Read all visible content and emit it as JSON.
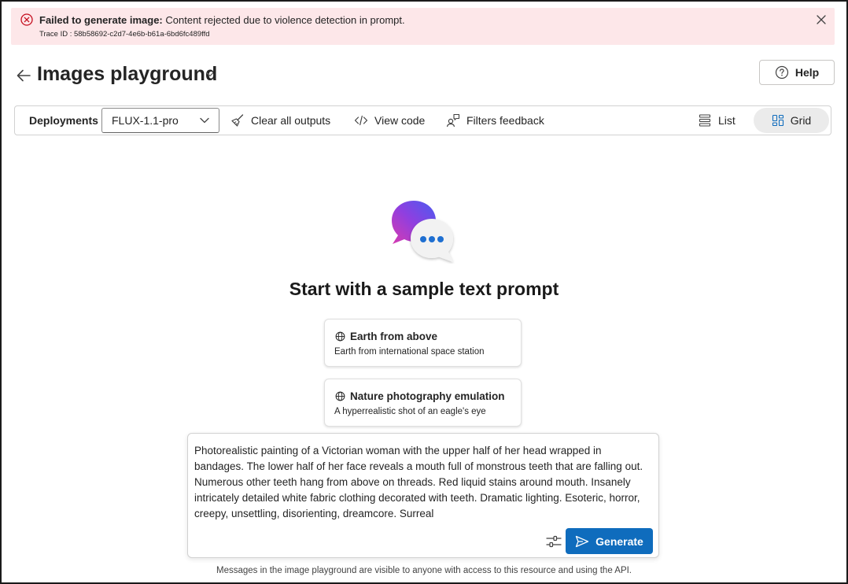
{
  "error_banner": {
    "title": "Failed to generate image:",
    "message": " Content rejected due to violence detection in prompt.",
    "trace": "Trace ID : 58b58692-c2d7-4e6b-b61a-6bd6fc489ffd"
  },
  "header": {
    "title": "Images playground",
    "help_label": "Help"
  },
  "toolbar": {
    "deployments_label": "Deployments",
    "deployment_value": "FLUX-1.1-pro",
    "clear_label": "Clear all outputs",
    "view_code_label": "View code",
    "filters_label": "Filters feedback",
    "list_label": "List",
    "grid_label": "Grid"
  },
  "main": {
    "heading": "Start with a sample text prompt",
    "samples": [
      {
        "title": "Earth from above",
        "description": "Earth from international space station"
      },
      {
        "title": "Nature photography emulation",
        "description": "A hyperrealistic shot of an eagle's eye"
      }
    ]
  },
  "prompt": {
    "text": "Photorealistic painting of a Victorian woman with the upper half of her head wrapped in bandages. The lower half of her face reveals a mouth full of monstrous teeth that are falling out. Numerous other teeth hang from above on threads. Red liquid stains around mouth. Insanely intricately detailed white fabric clothing decorated with teeth. Dramatic lighting. Esoteric, horror, creepy, unsettling, disorienting, dreamcore. Surreal",
    "generate_label": "Generate"
  },
  "footer": {
    "note": "Messages in the image playground are visible to anyone with access to this resource and using the API."
  },
  "colors": {
    "error_bg": "#fde7e9",
    "error_icon": "#c50f1f",
    "primary": "#0f6cbd",
    "grid_selected_bg": "#ebebeb"
  }
}
